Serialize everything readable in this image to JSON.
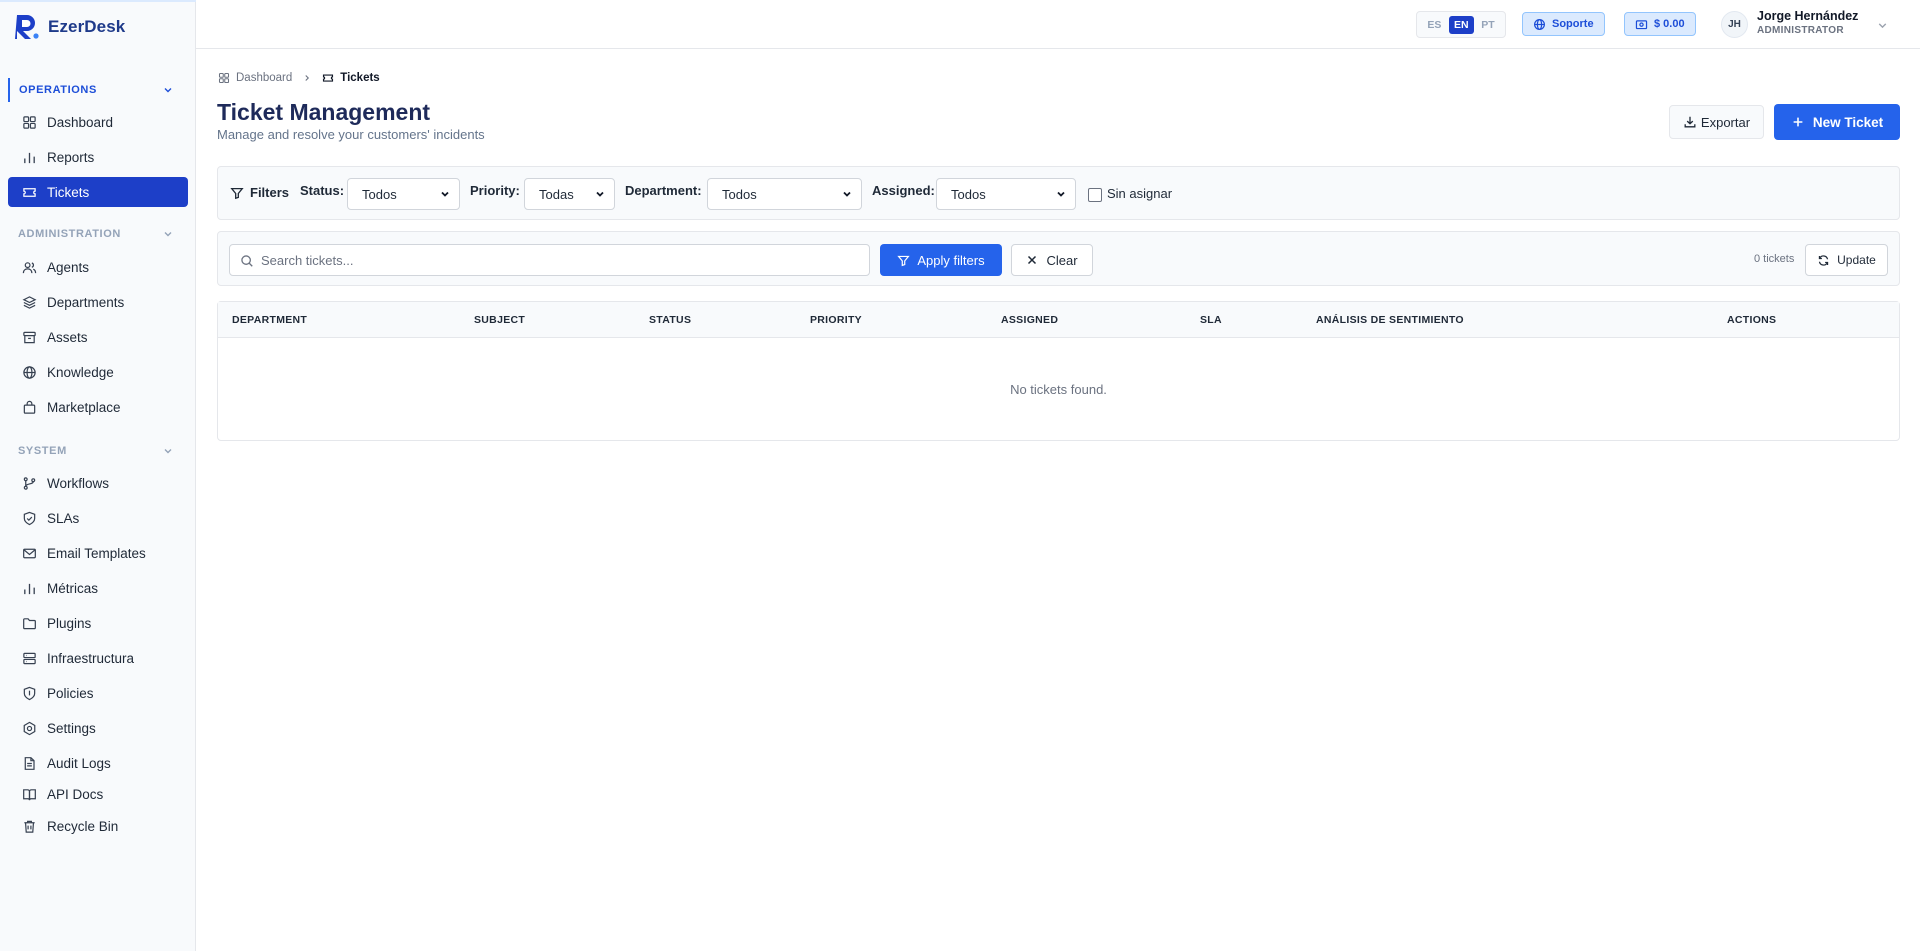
{
  "brand": {
    "name": "EzerDesk"
  },
  "sidebar": {
    "sections": [
      {
        "title": "OPERATIONS",
        "items": [
          "Dashboard",
          "Reports",
          "Tickets"
        ]
      },
      {
        "title": "ADMINISTRATION",
        "items": [
          "Agents",
          "Departments",
          "Assets",
          "Knowledge",
          "Marketplace"
        ]
      },
      {
        "title": "SYSTEM",
        "items": [
          "Workflows",
          "SLAs",
          "Email Templates",
          "Métricas",
          "Plugins",
          "Infraestructura",
          "Policies",
          "Settings",
          "Audit Logs",
          "API Docs",
          "Recycle Bin"
        ]
      }
    ],
    "active_item": "Tickets"
  },
  "topbar": {
    "languages": [
      "ES",
      "EN",
      "PT"
    ],
    "active_language": "EN",
    "support_label": "Soporte",
    "balance_label": "$ 0.00",
    "user": {
      "initials": "JH",
      "name": "Jorge Hernández",
      "role": "ADMINISTRATOR"
    }
  },
  "breadcrumb": {
    "home": "Dashboard",
    "current": "Tickets"
  },
  "page": {
    "title": "Ticket Management",
    "subtitle": "Manage and resolve your customers' incidents",
    "export_label": "Exportar",
    "new_ticket_label": "New Ticket"
  },
  "filters": {
    "title": "Filters",
    "status_label": "Status:",
    "status_value": "Todos",
    "priority_label": "Priority:",
    "priority_value": "Todas",
    "department_label": "Department:",
    "department_value": "Todos",
    "assigned_label": "Assigned:",
    "assigned_value": "Todos",
    "unassigned_label": "Sin asignar",
    "unassigned_checked": false
  },
  "search": {
    "placeholder": "Search tickets...",
    "value": "",
    "apply_label": "Apply filters",
    "clear_label": "Clear",
    "count_label": "0 tickets",
    "update_label": "Update"
  },
  "table": {
    "columns": [
      "DEPARTMENT",
      "SUBJECT",
      "STATUS",
      "PRIORITY",
      "ASSIGNED",
      "SLA",
      "ANÁLISIS DE SENTIMIENTO",
      "ACTIONS"
    ],
    "empty_message": "No tickets found."
  },
  "colors": {
    "accent": "#2563eb",
    "active_nav": "#1d3fc8",
    "title": "#1e2a5a"
  }
}
